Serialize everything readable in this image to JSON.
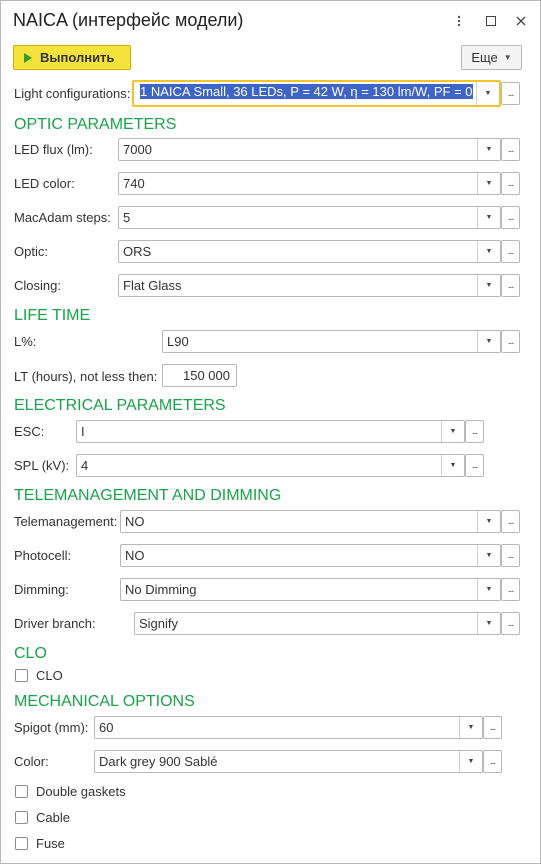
{
  "window": {
    "title": "NAICA (интерфейс модели)",
    "icons": [
      "more-vertical-icon",
      "maximize-icon",
      "close-icon"
    ]
  },
  "toolbar": {
    "run_label": "Выполнить",
    "more_label": "Еще"
  },
  "light_config": {
    "label": "Light configurations:",
    "value": "1 NAICA Small, 36 LEDs, P = 42 W, η = 130 lm/W, PF = 0"
  },
  "optic": {
    "title": "OPTIC PARAMETERS",
    "led_flux": {
      "label": "LED flux (lm):",
      "value": "7000"
    },
    "led_color": {
      "label": "LED color:",
      "value": "740"
    },
    "macadam": {
      "label": "MacAdam steps:",
      "value": "5"
    },
    "optic": {
      "label": "Optic:",
      "value": "ORS"
    },
    "closing": {
      "label": "Closing:",
      "value": "Flat Glass"
    }
  },
  "lifetime": {
    "title": "LIFE TIME",
    "l_percent": {
      "label": "L%:",
      "value": "L90"
    },
    "lt_hours": {
      "label": "LT (hours), not less then:",
      "value": "150 000"
    }
  },
  "electrical": {
    "title": "ELECTRICAL PARAMETERS",
    "esc": {
      "label": "ESC:",
      "value": "I"
    },
    "spl": {
      "label": "SPL (kV):",
      "value": "4"
    }
  },
  "telemanagement": {
    "title": "TELEMANAGEMENT AND DIMMING",
    "telemanagement": {
      "label": "Telemanagement:",
      "value": "NO"
    },
    "photocell": {
      "label": "Photocell:",
      "value": "NO"
    },
    "dimming": {
      "label": "Dimming:",
      "value": "No Dimming"
    },
    "driver_branch": {
      "label": "Driver branch:",
      "value": "Signify"
    }
  },
  "clo": {
    "title": "CLO",
    "checkbox_label": "CLO",
    "checked": false
  },
  "mechanical": {
    "title": "MECHANICAL OPTIONS",
    "spigot": {
      "label": "Spigot (mm):",
      "value": "60"
    },
    "color": {
      "label": "Color:",
      "value": "Dark grey 900 Sablé"
    },
    "double_gaskets": {
      "label": "Double gaskets",
      "checked": false
    },
    "cable": {
      "label": "Cable",
      "checked": false
    },
    "fuse": {
      "label": "Fuse",
      "checked": false
    }
  },
  "colors": {
    "section_title": "#19a34a",
    "run_button": "#f5e23a",
    "focus_border": "#f3c32a",
    "selection": "#3f64c8"
  }
}
